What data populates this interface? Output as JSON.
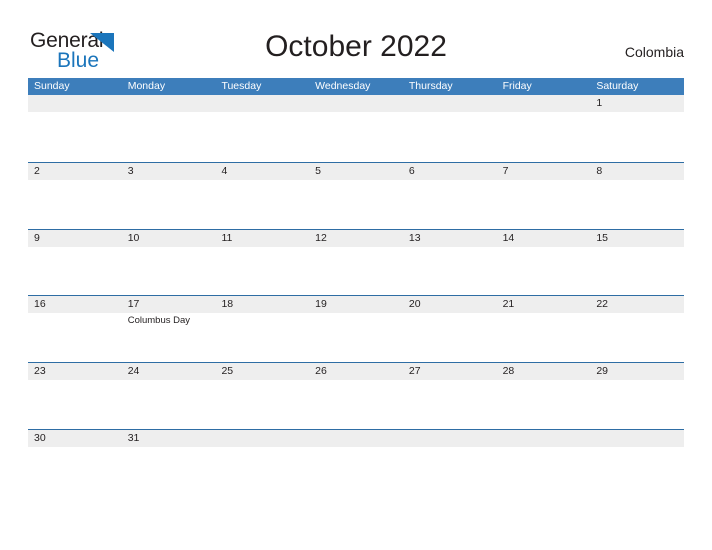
{
  "brand": {
    "name_part1": "General",
    "name_part2": "Blue",
    "triangle_color": "#1b75bb",
    "text_color": "#231f20",
    "blue_text_color": "#1b75bb"
  },
  "header": {
    "title": "October 2022",
    "country": "Colombia"
  },
  "calendar": {
    "accent_header_color": "#3d7ebb",
    "separator_color": "#2e6da4",
    "number_band_color": "#eeeeee",
    "day_headers": [
      "Sunday",
      "Monday",
      "Tuesday",
      "Wednesday",
      "Thursday",
      "Friday",
      "Saturday"
    ],
    "weeks": [
      {
        "days": [
          {
            "number": "",
            "events": []
          },
          {
            "number": "",
            "events": []
          },
          {
            "number": "",
            "events": []
          },
          {
            "number": "",
            "events": []
          },
          {
            "number": "",
            "events": []
          },
          {
            "number": "",
            "events": []
          },
          {
            "number": "1",
            "events": []
          }
        ]
      },
      {
        "days": [
          {
            "number": "2",
            "events": []
          },
          {
            "number": "3",
            "events": []
          },
          {
            "number": "4",
            "events": []
          },
          {
            "number": "5",
            "events": []
          },
          {
            "number": "6",
            "events": []
          },
          {
            "number": "7",
            "events": []
          },
          {
            "number": "8",
            "events": []
          }
        ]
      },
      {
        "days": [
          {
            "number": "9",
            "events": []
          },
          {
            "number": "10",
            "events": []
          },
          {
            "number": "11",
            "events": []
          },
          {
            "number": "12",
            "events": []
          },
          {
            "number": "13",
            "events": []
          },
          {
            "number": "14",
            "events": []
          },
          {
            "number": "15",
            "events": []
          }
        ]
      },
      {
        "days": [
          {
            "number": "16",
            "events": []
          },
          {
            "number": "17",
            "events": [
              "Columbus Day"
            ]
          },
          {
            "number": "18",
            "events": []
          },
          {
            "number": "19",
            "events": []
          },
          {
            "number": "20",
            "events": []
          },
          {
            "number": "21",
            "events": []
          },
          {
            "number": "22",
            "events": []
          }
        ]
      },
      {
        "days": [
          {
            "number": "23",
            "events": []
          },
          {
            "number": "24",
            "events": []
          },
          {
            "number": "25",
            "events": []
          },
          {
            "number": "26",
            "events": []
          },
          {
            "number": "27",
            "events": []
          },
          {
            "number": "28",
            "events": []
          },
          {
            "number": "29",
            "events": []
          }
        ]
      },
      {
        "days": [
          {
            "number": "30",
            "events": []
          },
          {
            "number": "31",
            "events": []
          },
          {
            "number": "",
            "events": []
          },
          {
            "number": "",
            "events": []
          },
          {
            "number": "",
            "events": []
          },
          {
            "number": "",
            "events": []
          },
          {
            "number": "",
            "events": []
          }
        ]
      }
    ]
  }
}
